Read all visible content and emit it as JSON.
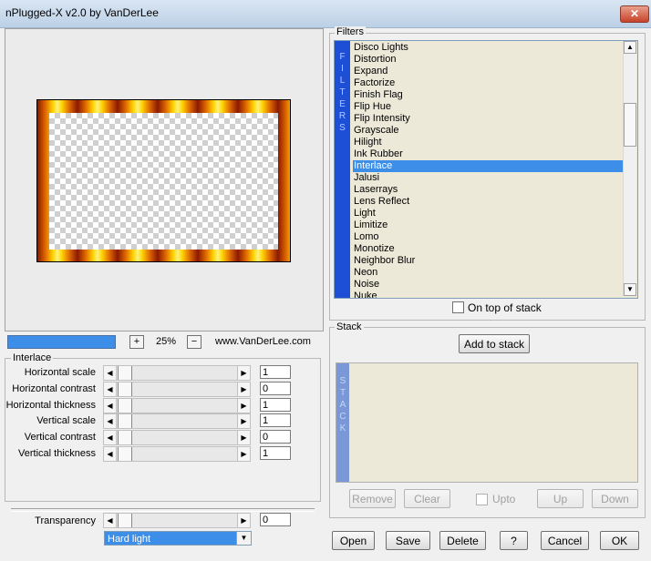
{
  "window": {
    "title": "nPlugged-X v2.0 by VanDerLee",
    "close_label": "✕"
  },
  "zoom": {
    "progress_percent": 100,
    "minus_label": "−",
    "plus_label": "+",
    "value": "25%",
    "website": "www.VanDerLee.com"
  },
  "interlace": {
    "group_label": "Interlace",
    "params": [
      {
        "label": "Horizontal scale",
        "value": "1"
      },
      {
        "label": "Horizontal contrast",
        "value": "0"
      },
      {
        "label": "Horizontal thickness",
        "value": "1"
      },
      {
        "label": "Vertical scale",
        "value": "1"
      },
      {
        "label": "Vertical contrast",
        "value": "0"
      },
      {
        "label": "Vertical thickness",
        "value": "1"
      }
    ]
  },
  "transparency": {
    "label": "Transparency",
    "value": "0"
  },
  "blend_mode": {
    "selected": "Hard light"
  },
  "filters": {
    "group_label": "Filters",
    "strip_letters": [
      "F",
      "I",
      "L",
      "T",
      "E",
      "R",
      "S"
    ],
    "items": [
      "Disco Lights",
      "Distortion",
      "Expand",
      "Factorize",
      "Finish Flag",
      "Flip Hue",
      "Flip Intensity",
      "Grayscale",
      "Hilight",
      "Ink Rubber",
      "Interlace",
      "Jalusi",
      "Laserrays",
      "Lens Reflect",
      "Light",
      "Limitize",
      "Lomo",
      "Monotize",
      "Neighbor Blur",
      "Neon",
      "Noise",
      "Nuke"
    ],
    "selected": "Interlace",
    "on_top_label": "On top of stack"
  },
  "stack": {
    "group_label": "Stack",
    "add_label": "Add to stack",
    "strip_letters": [
      "S",
      "T",
      "A",
      "C",
      "K"
    ],
    "remove_label": "Remove",
    "clear_label": "Clear",
    "upto_label": "Upto",
    "up_label": "Up",
    "down_label": "Down"
  },
  "footer": {
    "open": "Open",
    "save": "Save",
    "delete": "Delete",
    "help": "?",
    "cancel": "Cancel",
    "ok": "OK"
  },
  "icons": {
    "arrow_left": "◀",
    "arrow_right": "▶",
    "arrow_up": "▲",
    "arrow_down": "▼"
  },
  "colors": {
    "selection": "#3c8ee8",
    "filter_strip": "#1c4fd6",
    "stack_strip": "#7a98d8"
  }
}
